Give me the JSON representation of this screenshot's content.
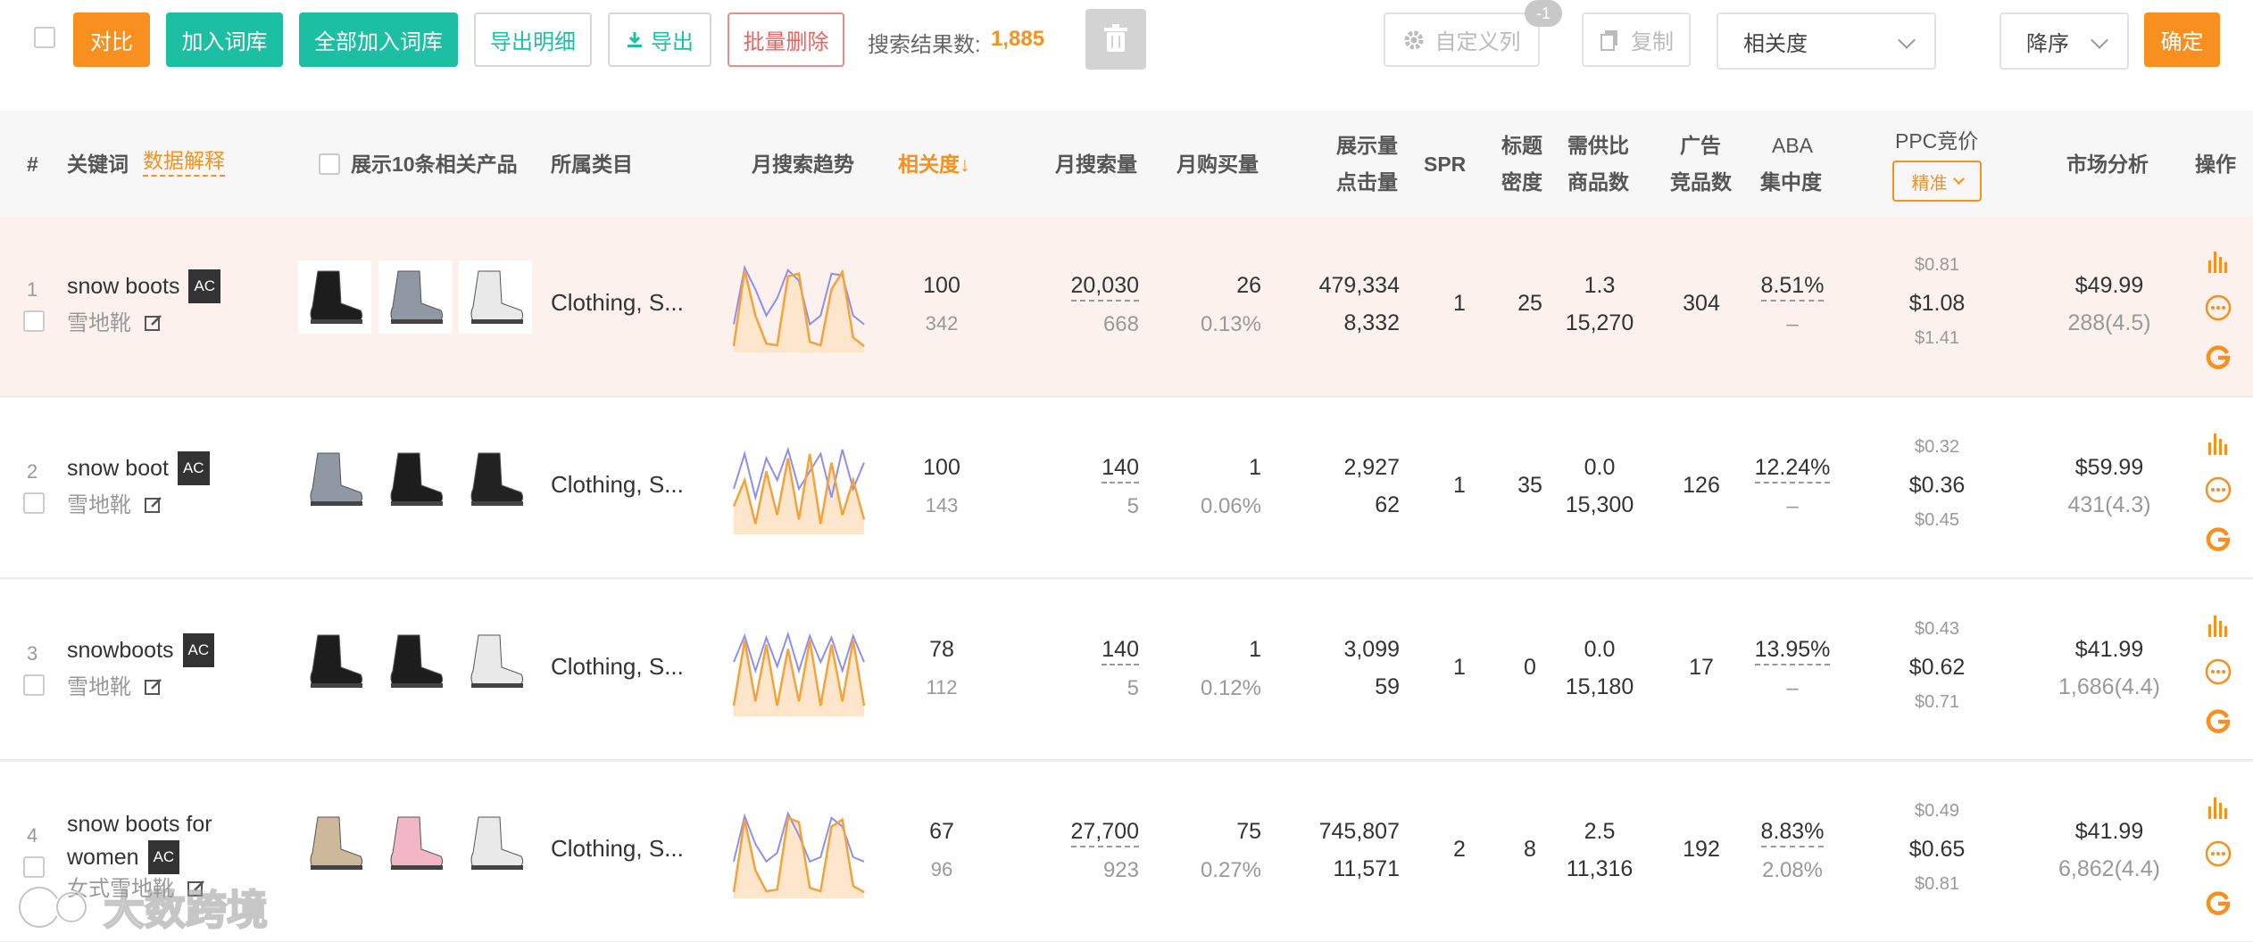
{
  "toolbar": {
    "compare": "对比",
    "add_to_lib": "加入词库",
    "add_all_to_lib": "全部加入词库",
    "export_detail": "导出明细",
    "export": "导出",
    "batch_delete": "批量删除",
    "result_label": "搜索结果数:",
    "result_count": "1,885",
    "custom_columns": "自定义列",
    "custom_badge": "-1",
    "copy": "复制",
    "sort_field": "相关度",
    "sort_order": "降序",
    "confirm": "确定"
  },
  "header": {
    "num": "#",
    "keyword": "关键词",
    "data_explain": "数据解释",
    "show_products": "展示10条相关产品",
    "category": "所属类目",
    "trend": "月搜索趋势",
    "relevance": "相关度↓",
    "monthly_search": "月搜索量",
    "monthly_purchase": "月购买量",
    "impressions": "展示量",
    "clicks": "点击量",
    "spr": "SPR",
    "title_density_1": "标题",
    "title_density_2": "密度",
    "supply_demand": "需供比",
    "product_count": "商品数",
    "ad_1": "广告",
    "ad_2": "竞品数",
    "aba_1": "ABA",
    "aba_2": "集中度",
    "ppc": "PPC竞价",
    "ppc_mode": "精准",
    "market": "市场分析",
    "actions": "操作"
  },
  "rows": [
    {
      "num": "1",
      "keyword": "snow boots",
      "ac": "AC",
      "cn": "雪地靴",
      "category": "Clothing, S...",
      "relevance": "100",
      "relevance_sub": "342",
      "search": "20,030",
      "search_sub": "668",
      "purchase": "26",
      "purchase_rate": "0.13%",
      "impressions": "479,334",
      "clicks": "8,332",
      "spr": "1",
      "title_density": "25",
      "supply_ratio": "1.3",
      "product_count": "15,270",
      "ad_count": "304",
      "aba": "8.51%",
      "aba_sub": "–",
      "ppc_low": "$0.81",
      "ppc_mid": "$1.08",
      "ppc_high": "$1.41",
      "price": "$49.99",
      "rating": "288(4.5)",
      "shoes": [
        "#1d1d1d",
        "#8f98a3",
        "#e9e9e9"
      ],
      "trend_a": [
        5,
        92,
        40,
        8,
        6,
        85,
        88,
        10,
        6,
        70,
        90,
        15,
        5
      ],
      "trend_b": [
        30,
        95,
        70,
        40,
        60,
        92,
        80,
        30,
        40,
        88,
        86,
        40,
        30
      ]
    },
    {
      "num": "2",
      "keyword": "snow boot",
      "ac": "AC",
      "cn": "雪地靴",
      "category": "Clothing, S...",
      "relevance": "100",
      "relevance_sub": "143",
      "search": "140",
      "search_sub": "5",
      "purchase": "1",
      "purchase_rate": "0.06%",
      "impressions": "2,927",
      "clicks": "62",
      "spr": "1",
      "title_density": "35",
      "supply_ratio": "0.0",
      "product_count": "15,300",
      "ad_count": "126",
      "aba": "12.24%",
      "aba_sub": "–",
      "ppc_low": "$0.32",
      "ppc_mid": "$0.36",
      "ppc_high": "$0.45",
      "price": "$59.99",
      "rating": "431(4.3)",
      "shoes": [
        "#8f98a3",
        "#1d1d1d",
        "#222"
      ],
      "trend_a": [
        30,
        60,
        10,
        70,
        20,
        85,
        15,
        90,
        10,
        80,
        20,
        60,
        15
      ],
      "trend_b": [
        50,
        90,
        40,
        85,
        60,
        95,
        50,
        70,
        90,
        40,
        95,
        50,
        80
      ]
    },
    {
      "num": "3",
      "keyword": "snowboots",
      "ac": "AC",
      "cn": "雪地靴",
      "category": "Clothing, S...",
      "relevance": "78",
      "relevance_sub": "112",
      "search": "140",
      "search_sub": "5",
      "purchase": "1",
      "purchase_rate": "0.12%",
      "impressions": "3,099",
      "clicks": "59",
      "spr": "1",
      "title_density": "0",
      "supply_ratio": "0.0",
      "product_count": "15,180",
      "ad_count": "17",
      "aba": "13.95%",
      "aba_sub": "–",
      "ppc_low": "$0.43",
      "ppc_mid": "$0.62",
      "ppc_high": "$0.71",
      "price": "$41.99",
      "rating": "1,686(4.4)",
      "shoes": [
        "#1d1d1d",
        "#1d1d1d",
        "#e9e9e9"
      ],
      "trend_a": [
        10,
        85,
        15,
        80,
        10,
        75,
        15,
        85,
        10,
        80,
        15,
        85,
        10
      ],
      "trend_b": [
        60,
        90,
        50,
        88,
        55,
        92,
        50,
        90,
        60,
        88,
        50,
        90,
        60
      ]
    },
    {
      "num": "4",
      "keyword": "snow boots for women",
      "ac": "AC",
      "cn": "女式雪地靴",
      "category": "Clothing, S...",
      "relevance": "67",
      "relevance_sub": "96",
      "search": "27,700",
      "search_sub": "923",
      "purchase": "75",
      "purchase_rate": "0.27%",
      "impressions": "745,807",
      "clicks": "11,571",
      "spr": "2",
      "title_density": "8",
      "supply_ratio": "2.5",
      "product_count": "11,316",
      "ad_count": "192",
      "aba": "8.83%",
      "aba_sub": "2.08%",
      "ppc_low": "$0.49",
      "ppc_mid": "$0.65",
      "ppc_high": "$0.81",
      "price": "$41.99",
      "rating": "6,862(4.4)",
      "shoes": [
        "#cdb89a",
        "#f2b7c7",
        "#e9e9e9"
      ],
      "trend_a": [
        5,
        88,
        30,
        6,
        8,
        90,
        85,
        10,
        6,
        80,
        88,
        12,
        5
      ],
      "trend_b": [
        40,
        92,
        60,
        40,
        50,
        95,
        70,
        40,
        45,
        90,
        80,
        45,
        40
      ]
    }
  ],
  "watermark": "大数跨境",
  "colors": {
    "orange": "#f7901e",
    "teal": "#1cbfa2",
    "red": "#ef6060",
    "trend_orange": "#f5a23a",
    "trend_blue": "#8d8ff0"
  }
}
